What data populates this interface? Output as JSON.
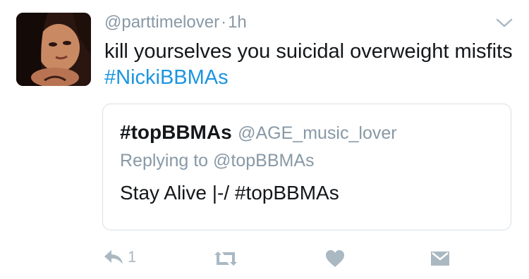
{
  "tweet": {
    "username": "@parttimelover",
    "separator": "·",
    "time": "1h",
    "text_plain": "kill yourselves you suicidal overweight misfits ",
    "hashtag": "#NickiBBMAs"
  },
  "quoted_tweet": {
    "name": "#topBBMAs",
    "handle": "@AGE_music_lover",
    "replying_prefix": "Replying to ",
    "replying_mention": "@topBBMAs",
    "text": "Stay Alive |-/ #topBBMAs"
  },
  "actions": {
    "reply_count": "1",
    "icons": [
      "reply-icon",
      "retweet-icon",
      "heart-icon",
      "direct-message-icon"
    ]
  },
  "colors": {
    "text": "#14171a",
    "muted": "#8899a6",
    "link": "#1b95e0",
    "icon": "#aab8c2",
    "border": "#d8e0e6"
  }
}
